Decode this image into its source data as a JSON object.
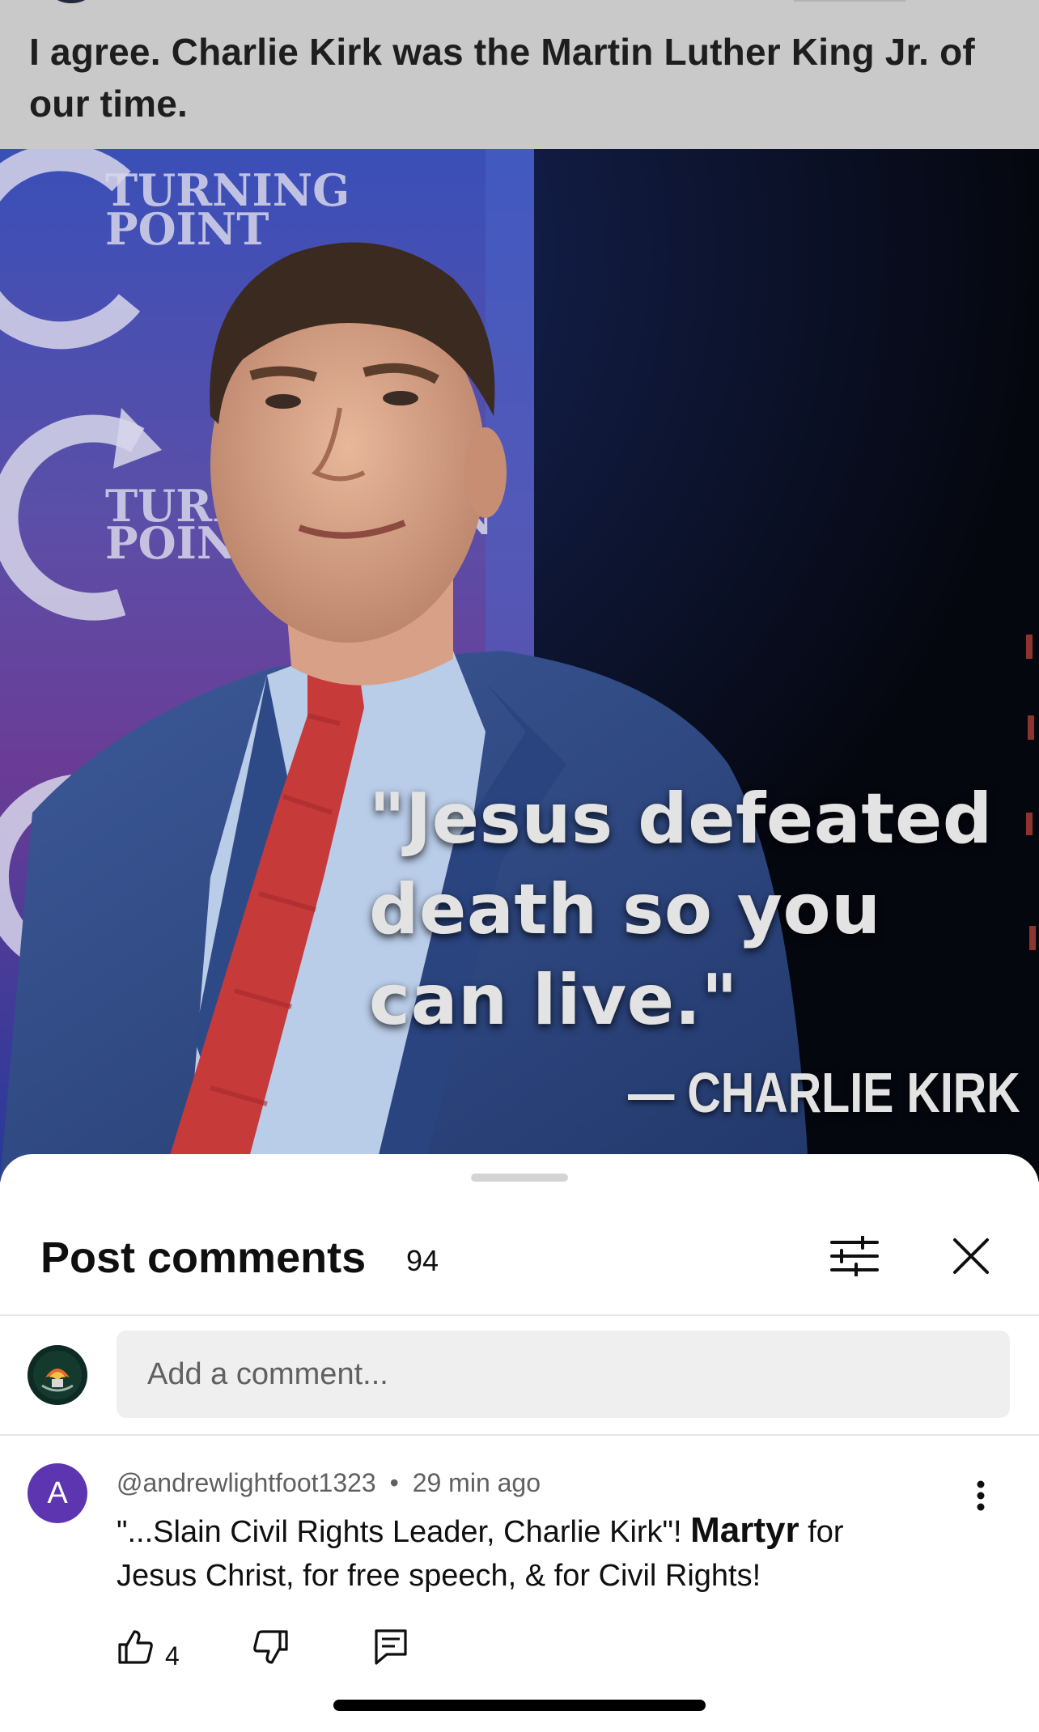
{
  "post": {
    "text": "I agree. Charlie Kirk was the Martin Luther King Jr. of our time.",
    "image": {
      "quote_lines": [
        "\"Jesus defeated",
        "death so you",
        "can live.\""
      ],
      "attribution": "— CHARLIE KIRK",
      "backdrop_logo_text": [
        "TURNING",
        "POINT"
      ]
    }
  },
  "comments_sheet": {
    "title": "Post comments",
    "count": "94",
    "filter_icon": "sliders-icon",
    "close_icon": "close-icon",
    "input_placeholder": "Add a comment...",
    "comments": [
      {
        "avatar_letter": "A",
        "avatar_color": "#5e35b1",
        "author": "@andrewlightfoot1323",
        "separator": "•",
        "time": "29 min ago",
        "text_part1": "\"...Slain Civil Rights Leader, Charlie Kirk\"! ",
        "text_bold": "Martyr",
        "text_part2": " for Jesus Christ, for free speech, & for Civil Rights!",
        "likes": "4"
      }
    ]
  }
}
